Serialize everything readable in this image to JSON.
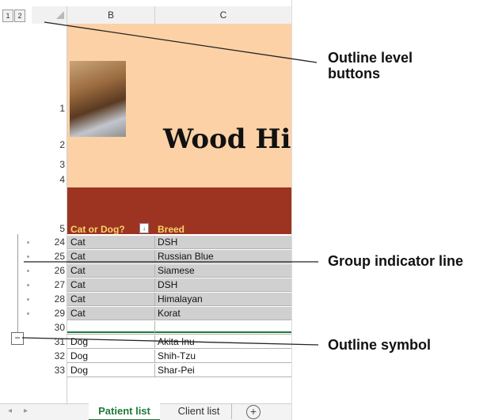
{
  "outline_levels": [
    "1",
    "2"
  ],
  "columns": [
    "B",
    "C"
  ],
  "banner": {
    "title": "Wood Hi",
    "row_numbers": [
      "1",
      "2",
      "3",
      "4",
      "5"
    ]
  },
  "table_headers": {
    "col1": "Cat or Dog?",
    "filter_icon": "↓",
    "col2": "Breed"
  },
  "rows": [
    {
      "num": "24",
      "animal": "Cat",
      "breed": "DSH"
    },
    {
      "num": "25",
      "animal": "Cat",
      "breed": "Russian Blue"
    },
    {
      "num": "26",
      "animal": "Cat",
      "breed": "Siamese"
    },
    {
      "num": "27",
      "animal": "Cat",
      "breed": "DSH"
    },
    {
      "num": "28",
      "animal": "Cat",
      "breed": "Himalayan"
    },
    {
      "num": "29",
      "animal": "Cat",
      "breed": "Korat"
    },
    {
      "num": "30",
      "animal": "",
      "breed": ""
    },
    {
      "num": "31",
      "animal": "Dog",
      "breed": "Akita Inu"
    },
    {
      "num": "32",
      "animal": "Dog",
      "breed": "Shih-Tzu"
    },
    {
      "num": "33",
      "animal": "Dog",
      "breed": "Shar-Pei"
    }
  ],
  "collapse_symbol": "−",
  "tabs": {
    "active": "Patient list",
    "other": "Client list",
    "add": "+",
    "prev": "◂",
    "next": "▸"
  },
  "callouts": {
    "outline_level_line1": "Outline level",
    "outline_level_line2": "buttons",
    "group_indicator": "Group indicator line",
    "outline_symbol": "Outline symbol"
  },
  "colors": {
    "banner": "#fcd1a6",
    "header_band": "#9c3421",
    "header_text": "#f7d46a",
    "grouped_rows": "#d0d0d0",
    "active_tab": "#1f7a3a"
  }
}
